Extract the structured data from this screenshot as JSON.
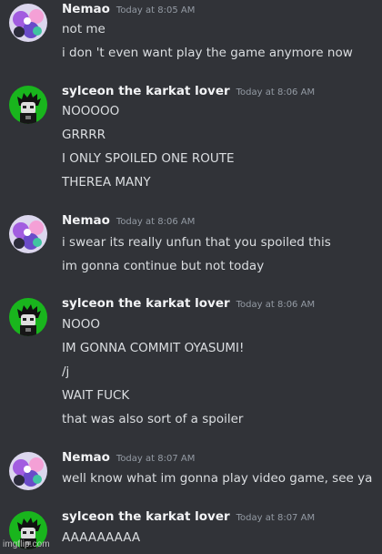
{
  "messages": [
    {
      "author": "Nemao",
      "timestamp": "Today at 8:05 AM",
      "avatar_icon": "nemao-avatar-icon",
      "lines": [
        "not me",
        "i don 't even want play the game anymore now"
      ]
    },
    {
      "author": "sylceon the karkat lover",
      "timestamp": "Today at 8:06 AM",
      "avatar_icon": "karkat-avatar-icon",
      "lines": [
        "NOOOOO",
        "GRRRR",
        "I ONLY SPOILED ONE ROUTE",
        "THEREA MANY"
      ]
    },
    {
      "author": "Nemao",
      "timestamp": "Today at 8:06 AM",
      "avatar_icon": "nemao-avatar-icon",
      "lines": [
        "i swear its really unfun that you spoiled this",
        "im gonna continue but not today"
      ]
    },
    {
      "author": "sylceon the karkat lover",
      "timestamp": "Today at 8:06 AM",
      "avatar_icon": "karkat-avatar-icon",
      "lines": [
        "NOOO",
        "IM GONNA COMMIT OYASUMI!",
        "/j",
        "WAIT FUCK",
        "that was also sort of a spoiler"
      ]
    },
    {
      "author": "Nemao",
      "timestamp": "Today at 8:07 AM",
      "avatar_icon": "nemao-avatar-icon",
      "lines": [
        "well know what im gonna play video game, see ya"
      ]
    },
    {
      "author": "sylceon the karkat lover",
      "timestamp": "Today at 8:07 AM",
      "avatar_icon": "karkat-avatar-icon",
      "lines": [
        "AAAAAAAAA"
      ]
    }
  ],
  "watermark": "imgflip.com",
  "colors": {
    "background": "#313338",
    "author": "#f2f3f5",
    "timestamp": "#949ba4",
    "text": "#dbdee1"
  }
}
